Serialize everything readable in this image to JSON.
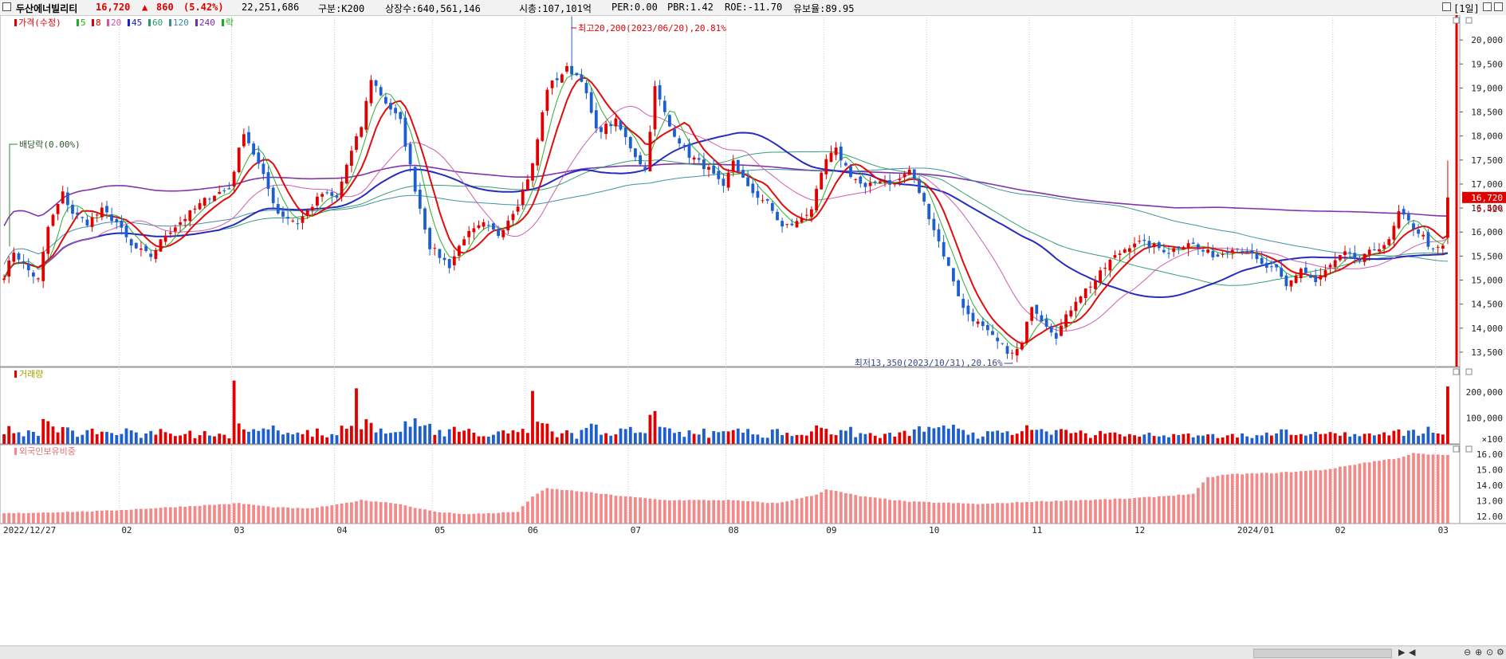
{
  "header": {
    "name": "두산에너빌리티",
    "price": "16,720",
    "change_arrow": "▲",
    "change": "860",
    "change_pct": "(5.42%)",
    "volume": "22,251,686",
    "market": "구분:K200",
    "shares": "상장수:640,561,146",
    "market_cap": "시총:107,101억",
    "per": "PER:0.00",
    "pbr": "PBR:1.42",
    "roe": "ROE:-11.70",
    "float_ratio": "유보율:89.95",
    "period_btn": "[1일]"
  },
  "colors": {
    "up": "#e00000",
    "down": "#1e5fd0",
    "ma5": "#22aa22",
    "ma8": "#dd0000",
    "ma20": "#cc55aa",
    "ma45": "#1a22bb",
    "ma60": "#2a9a6a",
    "ma120": "#3a8aa0",
    "ma240": "#7a2aa8",
    "foreign": "#f28a8a"
  },
  "legend": [
    {
      "label": "가격(수정)",
      "color": "#dd0000"
    },
    {
      "label": "5",
      "color": "#22aa22"
    },
    {
      "label": "8",
      "color": "#dd0000"
    },
    {
      "label": "20",
      "color": "#cc55aa"
    },
    {
      "label": "45",
      "color": "#1a22bb"
    },
    {
      "label": "60",
      "color": "#2a9a6a"
    },
    {
      "label": "120",
      "color": "#3a8aa0"
    },
    {
      "label": "240",
      "color": "#7a2aa8"
    },
    {
      "label": "락",
      "color": "#22aa22"
    }
  ],
  "chart_data": {
    "type": "candlestick",
    "price_axis": {
      "ticks": [
        "20,000",
        "19,500",
        "19,000",
        "18,500",
        "18,000",
        "17,500",
        "17,000",
        "16,500",
        "16,000",
        "15,500",
        "15,000",
        "14,500",
        "14,000",
        "13,500"
      ],
      "range": [
        13200,
        20450
      ]
    },
    "current_price_label": "16,720",
    "current_change_label": "5.42%",
    "annotations": {
      "high": "최고20,200(2023/06/20),20.81%",
      "low": "최저13,350(2023/10/31),20.16%",
      "dividend": "배당락(0.00%)"
    },
    "x_labels": [
      "2022/12/27",
      "02",
      "03",
      "04",
      "05",
      "06",
      "07",
      "08",
      "09",
      "10",
      "11",
      "12",
      "2024/01",
      "02",
      "03"
    ],
    "x_label_days": [
      0,
      24,
      47,
      68,
      88,
      107,
      128,
      148,
      168,
      189,
      210,
      231,
      252,
      272,
      293
    ],
    "anchors": [
      [
        0,
        15100
      ],
      [
        2,
        15600
      ],
      [
        5,
        15200
      ],
      [
        7,
        15000
      ],
      [
        9,
        16100
      ],
      [
        12,
        16800
      ],
      [
        14,
        16400
      ],
      [
        17,
        16200
      ],
      [
        20,
        16450
      ],
      [
        23,
        16200
      ],
      [
        26,
        15700
      ],
      [
        30,
        15500
      ],
      [
        33,
        15950
      ],
      [
        37,
        16300
      ],
      [
        42,
        16750
      ],
      [
        46,
        16900
      ],
      [
        49,
        18100
      ],
      [
        52,
        17400
      ],
      [
        56,
        16400
      ],
      [
        60,
        16200
      ],
      [
        65,
        16800
      ],
      [
        68,
        16700
      ],
      [
        70,
        17400
      ],
      [
        73,
        18200
      ],
      [
        75,
        19200
      ],
      [
        78,
        18700
      ],
      [
        81,
        18300
      ],
      [
        84,
        16900
      ],
      [
        87,
        15700
      ],
      [
        91,
        15300
      ],
      [
        94,
        15900
      ],
      [
        98,
        16150
      ],
      [
        101,
        15950
      ],
      [
        105,
        16600
      ],
      [
        108,
        17400
      ],
      [
        111,
        19000
      ],
      [
        115,
        19400
      ],
      [
        118,
        19200
      ],
      [
        121,
        18100
      ],
      [
        125,
        18300
      ],
      [
        129,
        17600
      ],
      [
        131,
        17300
      ],
      [
        133,
        19000
      ],
      [
        136,
        18200
      ],
      [
        140,
        17600
      ],
      [
        144,
        17300
      ],
      [
        147,
        16900
      ],
      [
        149,
        17500
      ],
      [
        152,
        16900
      ],
      [
        156,
        16600
      ],
      [
        159,
        16100
      ],
      [
        162,
        16200
      ],
      [
        165,
        16500
      ],
      [
        168,
        17500
      ],
      [
        170,
        17700
      ],
      [
        173,
        17200
      ],
      [
        176,
        16900
      ],
      [
        179,
        17100
      ],
      [
        182,
        17000
      ],
      [
        185,
        17300
      ],
      [
        188,
        16600
      ],
      [
        191,
        15800
      ],
      [
        194,
        15000
      ],
      [
        196,
        14400
      ],
      [
        200,
        14000
      ],
      [
        203,
        13700
      ],
      [
        206,
        13450
      ],
      [
        208,
        13650
      ],
      [
        210,
        14500
      ],
      [
        212,
        14200
      ],
      [
        215,
        13850
      ],
      [
        219,
        14600
      ],
      [
        223,
        15000
      ],
      [
        226,
        15400
      ],
      [
        229,
        15650
      ],
      [
        231,
        15800
      ],
      [
        235,
        15700
      ],
      [
        238,
        15600
      ],
      [
        242,
        15800
      ],
      [
        245,
        15600
      ],
      [
        248,
        15500
      ],
      [
        251,
        15700
      ],
      [
        254,
        15600
      ],
      [
        257,
        15300
      ],
      [
        260,
        15200
      ],
      [
        262,
        14850
      ],
      [
        265,
        15250
      ],
      [
        268,
        14950
      ],
      [
        271,
        15300
      ],
      [
        274,
        15550
      ],
      [
        277,
        15400
      ],
      [
        280,
        15650
      ],
      [
        283,
        15800
      ],
      [
        285,
        16400
      ],
      [
        288,
        16100
      ],
      [
        290,
        15900
      ],
      [
        292,
        15600
      ],
      [
        294,
        15700
      ],
      [
        295,
        16720
      ]
    ],
    "n_days": 296,
    "volume": {
      "label": "거래량",
      "ticks": [
        "200,000",
        "100,000"
      ],
      "unit": "×100",
      "range": [
        0,
        290000
      ]
    },
    "foreign_ownership": {
      "label": "외국인보유비중",
      "ticks": [
        "16.00",
        "15.00",
        "14.00",
        "13.00",
        "12.00"
      ],
      "range": [
        11.55,
        16.45
      ],
      "anchors": [
        [
          0,
          12.2
        ],
        [
          20,
          12.35
        ],
        [
          40,
          12.7
        ],
        [
          48,
          12.85
        ],
        [
          55,
          12.6
        ],
        [
          62,
          12.5
        ],
        [
          68,
          12.75
        ],
        [
          73,
          13.05
        ],
        [
          80,
          12.85
        ],
        [
          88,
          12.3
        ],
        [
          95,
          12.15
        ],
        [
          105,
          12.3
        ],
        [
          108,
          13.3
        ],
        [
          111,
          13.8
        ],
        [
          118,
          13.6
        ],
        [
          125,
          13.35
        ],
        [
          135,
          13.05
        ],
        [
          148,
          13.05
        ],
        [
          158,
          12.85
        ],
        [
          166,
          13.4
        ],
        [
          168,
          13.75
        ],
        [
          175,
          13.3
        ],
        [
          185,
          12.95
        ],
        [
          200,
          12.8
        ],
        [
          210,
          12.95
        ],
        [
          230,
          13.15
        ],
        [
          243,
          13.45
        ],
        [
          246,
          14.5
        ],
        [
          250,
          14.7
        ],
        [
          260,
          14.8
        ],
        [
          270,
          15.0
        ],
        [
          278,
          15.45
        ],
        [
          285,
          15.75
        ],
        [
          288,
          16.05
        ],
        [
          292,
          15.95
        ],
        [
          295,
          15.95
        ]
      ]
    }
  }
}
